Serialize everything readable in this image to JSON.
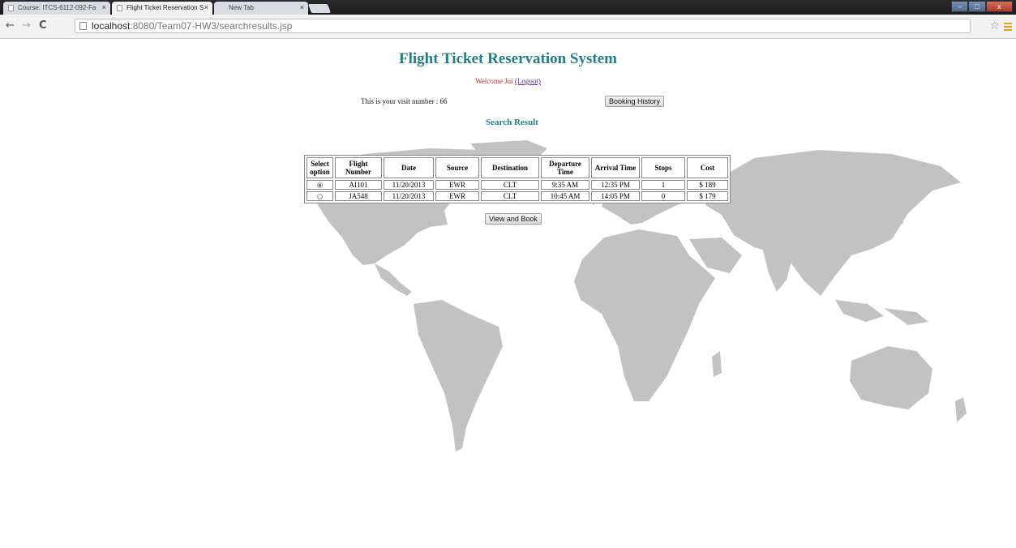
{
  "browser": {
    "tabs": [
      {
        "label": "Course: ITCS-6112-092-Fa"
      },
      {
        "label": "Flight Ticket Reservation S"
      },
      {
        "label": "New Tab"
      }
    ],
    "url_host": "localhost",
    "url_path": ":8080/Team07-HW3/searchresults.jsp"
  },
  "page": {
    "title": "Flight Ticket Reservation System",
    "welcome_text": "Welcome Jui",
    "logout_label": "(Logout)",
    "visit_text": "This is your visit number : 66",
    "booking_history_label": "Booking History",
    "search_result_heading": "Search Result",
    "view_book_label": "View and Book"
  },
  "results": {
    "headers": {
      "select": [
        "Select",
        "option"
      ],
      "flight": [
        "Flight",
        "Number"
      ],
      "date": "Date",
      "source": "Source",
      "destination": "Destination",
      "departure": [
        "Departure",
        "Time"
      ],
      "arrival": "Arrival Time",
      "stops": "Stops",
      "cost": "Cost"
    },
    "rows": [
      {
        "selected": true,
        "flight": "AI101",
        "date": "11/20/2013",
        "source": "EWR",
        "destination": "CLT",
        "departure": "9:35 AM",
        "arrival": "12:35 PM",
        "stops": "1",
        "cost": "$ 189"
      },
      {
        "selected": false,
        "flight": "JA548",
        "date": "11/20/2013",
        "source": "EWR",
        "destination": "CLT",
        "departure": "10:45 AM",
        "arrival": "14:05 PM",
        "stops": "0",
        "cost": "$ 179"
      }
    ]
  },
  "colors": {
    "accent": "#238080",
    "welcome": "#c03030",
    "map": "#c2c2c2"
  }
}
